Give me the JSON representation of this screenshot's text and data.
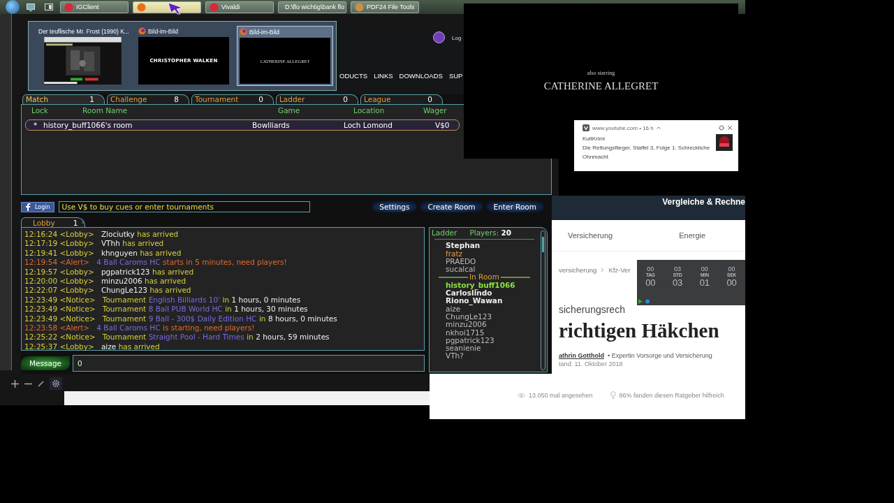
{
  "taskbar": {
    "tasks": [
      {
        "kind": "igclient",
        "label": "IGClient",
        "selected": false
      },
      {
        "kind": "firefox",
        "selected": true
      },
      {
        "kind": "vivaldi",
        "label": "Vivaldi",
        "selected": false
      },
      {
        "kind": "folder",
        "label": "D:\\flo wichtig\\bank flo",
        "selected": false
      },
      {
        "kind": "pdf",
        "label": "PDF24 File Tools",
        "selected": false
      }
    ]
  },
  "thumbnails": [
    {
      "kind": "browser",
      "title": "Der teuflische Mr. Frost (1990) K...",
      "selected": false
    },
    {
      "kind": "titlecard",
      "title": "Bild-im-Bild",
      "caption": "CHRISTOPHER WALKEN",
      "selected": false
    },
    {
      "kind": "titlecard",
      "title": "Bild-im-Bild",
      "caption": "CATHERINE ALLEGRET",
      "selected": true
    }
  ],
  "site_nav": {
    "items": [
      "ODUCTS",
      "LINKS",
      "DOWNLOADS",
      "SUP"
    ],
    "login": "Log"
  },
  "game": {
    "tabs": [
      {
        "label": "Match",
        "count": "1",
        "selected": true
      },
      {
        "label": "Challenge",
        "count": "8",
        "selected": false
      },
      {
        "label": "Tournament",
        "count": "0",
        "selected": false
      },
      {
        "label": "Ladder",
        "count": "0",
        "selected": false
      },
      {
        "label": "League",
        "count": "0",
        "selected": false
      }
    ],
    "columns": [
      "Lock",
      "Room Name",
      "Game",
      "Location",
      "Wager"
    ],
    "rooms": [
      {
        "lock": "*",
        "name": "history_buff1066's room",
        "game": "Bowlliards",
        "location": "Loch Lomond",
        "wager": "V$0",
        "selected": true
      }
    ],
    "login_button": "Login",
    "banner": "Use V$ to buy cues or enter tournaments",
    "buttons": [
      "Settings",
      "Create Room",
      "Enter Room"
    ],
    "chat_tab": {
      "label": "Lobby",
      "count": "1"
    },
    "messages": [
      {
        "kind": "lobby",
        "time": "12:16:24",
        "tag": "<Lobby>",
        "parts": [
          {
            "kind": "player",
            "text": "Zlociutky"
          },
          {
            "kind": "info",
            "text": "has arrived"
          }
        ]
      },
      {
        "kind": "lobby",
        "time": "12:17:19",
        "tag": "<Lobby>",
        "parts": [
          {
            "kind": "player",
            "text": "VThh"
          },
          {
            "kind": "info",
            "text": "has arrived"
          }
        ]
      },
      {
        "kind": "lobby",
        "time": "12:19:41",
        "tag": "<Lobby>",
        "parts": [
          {
            "kind": "player",
            "text": "khnguyen"
          },
          {
            "kind": "info",
            "text": "has arrived"
          }
        ]
      },
      {
        "kind": "alert",
        "time": "12:19:54",
        "tag": "<Alert>",
        "parts": [
          {
            "kind": "event",
            "text": "4 Ball Caroms HC"
          },
          {
            "kind": "info",
            "text": "starts in 5 minutes, need players!"
          }
        ]
      },
      {
        "kind": "lobby",
        "time": "12:19:57",
        "tag": "<Lobby>",
        "parts": [
          {
            "kind": "player",
            "text": "pgpatrick123"
          },
          {
            "kind": "info",
            "text": "has arrived"
          }
        ]
      },
      {
        "kind": "lobby",
        "time": "12:20:00",
        "tag": "<Lobby>",
        "parts": [
          {
            "kind": "player",
            "text": "minzu2006"
          },
          {
            "kind": "info",
            "text": "has arrived"
          }
        ]
      },
      {
        "kind": "lobby",
        "time": "12:22:07",
        "tag": "<Lobby>",
        "parts": [
          {
            "kind": "player",
            "text": "ChungLe123"
          },
          {
            "kind": "info",
            "text": "has arrived"
          }
        ]
      },
      {
        "kind": "notice",
        "time": "12:23:49",
        "tag": "<Notice>",
        "parts": [
          {
            "kind": "info",
            "text": "Tournament"
          },
          {
            "kind": "event",
            "text": "English Billiards 10'"
          },
          {
            "kind": "info",
            "text": "in"
          },
          {
            "kind": "player",
            "text": "1 hours, 0 minutes"
          }
        ]
      },
      {
        "kind": "notice",
        "time": "12:23:49",
        "tag": "<Notice>",
        "parts": [
          {
            "kind": "info",
            "text": "Tournament"
          },
          {
            "kind": "event",
            "text": "8 Ball PUB World HC"
          },
          {
            "kind": "info",
            "text": "in"
          },
          {
            "kind": "player",
            "text": "1 hours, 30 minutes"
          }
        ]
      },
      {
        "kind": "notice",
        "time": "12:23:49",
        "tag": "<Notice>",
        "parts": [
          {
            "kind": "info",
            "text": "Tournament"
          },
          {
            "kind": "event",
            "text": "9 Ball - 300$ Daily Edition HC"
          },
          {
            "kind": "info",
            "text": "in"
          },
          {
            "kind": "player",
            "text": "8 hours, 0 minutes"
          }
        ]
      },
      {
        "kind": "alert",
        "time": "12:23:58",
        "tag": "<Alert>",
        "parts": [
          {
            "kind": "event",
            "text": "4 Ball Caroms HC"
          },
          {
            "kind": "info",
            "text": "is starting, need players!"
          }
        ]
      },
      {
        "kind": "notice",
        "time": "12:25:22",
        "tag": "<Notice>",
        "parts": [
          {
            "kind": "info",
            "text": "Tournament"
          },
          {
            "kind": "event",
            "text": "Straight Pool - Hard Times"
          },
          {
            "kind": "info",
            "text": "in"
          },
          {
            "kind": "player",
            "text": "2 hours, 59 minutes"
          }
        ]
      },
      {
        "kind": "lobby",
        "time": "12:25:37",
        "tag": "<Lobby>",
        "parts": [
          {
            "kind": "player",
            "text": "aize"
          },
          {
            "kind": "info",
            "text": "has arrived"
          }
        ]
      }
    ],
    "message_button": "Message",
    "message_value": "0",
    "players": {
      "title": "Ladder",
      "count_label": "Players:",
      "count": "20",
      "list": [
        {
          "name": "Stephan",
          "kind": "normal"
        },
        {
          "name": "fratz",
          "kind": "ladder"
        },
        {
          "name": "PRAEDO",
          "kind": "faded"
        },
        {
          "name": "sucalcal",
          "kind": "faded"
        }
      ],
      "room_label": "In Room",
      "in_room": [
        {
          "name": "history_buff1066",
          "kind": "self"
        },
        {
          "name": "Carloslindo",
          "kind": "normal"
        },
        {
          "name": "Riono_Wawan",
          "kind": "normal"
        },
        {
          "name": "aize",
          "kind": "faded"
        },
        {
          "name": "ChungLe123",
          "kind": "faded"
        },
        {
          "name": "minzu2006",
          "kind": "faded"
        },
        {
          "name": "nkhoi1715",
          "kind": "faded"
        },
        {
          "name": "pgpatrick123",
          "kind": "faded"
        },
        {
          "name": "seanienie",
          "kind": "faded"
        },
        {
          "name": "VTh?",
          "kind": "faded"
        }
      ]
    }
  },
  "video": {
    "subtitle": "also starring",
    "title": "CATHERINE ALLEGRET"
  },
  "notification": {
    "source": "www.youtube.com",
    "age": "• 16 h",
    "title": "KultKrimi",
    "body": "Die Rettungsflieger, Staffel 3, Folge 1: Schreckliche Ohnmacht"
  },
  "web": {
    "header": "Vergleiche & Rechne",
    "nav": [
      "Versicherung",
      "Energie"
    ],
    "breadcrumb": [
      "versicherung",
      "Kfz-Ver"
    ],
    "kicker": "sicherungsrech",
    "heading": "richtigen Häkchen",
    "author": "athrin Gotthold",
    "author_role": "• Expertin Vorsorge und Versicherung",
    "date": "tand: 11. Oktober 2018",
    "views": "13.050 mal angesehen",
    "rating": "86% fanden diesen Ratgeber hilfreich"
  },
  "countdown": {
    "top_values": [
      "00",
      "03",
      "00",
      "00"
    ],
    "units": [
      {
        "label": "TAG",
        "value": "00"
      },
      {
        "label": "STD",
        "value": "03"
      },
      {
        "label": "MIN",
        "value": "01"
      },
      {
        "label": "SEK",
        "value": "00"
      }
    ]
  }
}
